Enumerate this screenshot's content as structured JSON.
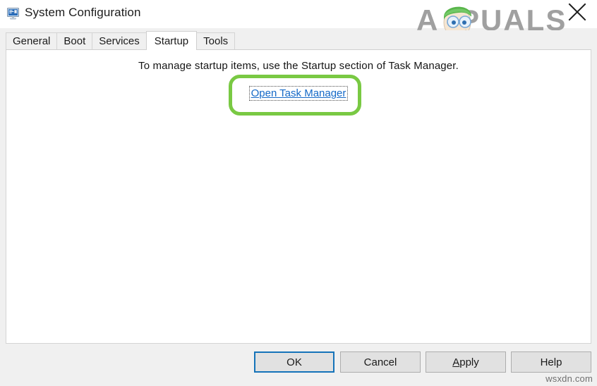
{
  "window": {
    "title": "System Configuration",
    "icon": "system-configuration-icon",
    "close_label": "✕"
  },
  "brand": {
    "name": "APPUALS",
    "logo_colors": {
      "text": "#9b9b9b",
      "hair": "#58b54a",
      "skin": "#f4e3cf"
    }
  },
  "tabs": [
    {
      "label": "General",
      "selected": false
    },
    {
      "label": "Boot",
      "selected": false
    },
    {
      "label": "Services",
      "selected": false
    },
    {
      "label": "Startup",
      "selected": true
    },
    {
      "label": "Tools",
      "selected": false
    }
  ],
  "content": {
    "instruction": "To manage startup items, use the Startup section of Task Manager.",
    "link_label": "Open Task Manager",
    "link_color": "#1569c7",
    "highlight_color": "#79c943"
  },
  "footer": {
    "buttons": [
      {
        "label": "OK",
        "default": true,
        "accel": ""
      },
      {
        "label": "Cancel",
        "default": false,
        "accel": ""
      },
      {
        "label": "Apply",
        "default": false,
        "accel": "A"
      },
      {
        "label": "Help",
        "default": false,
        "accel": ""
      }
    ],
    "ok_label": "OK",
    "cancel_label": "Cancel",
    "apply_accel": "A",
    "apply_rest": "pply",
    "help_label": "Help"
  },
  "watermark": {
    "text": "wsxdn.com"
  }
}
